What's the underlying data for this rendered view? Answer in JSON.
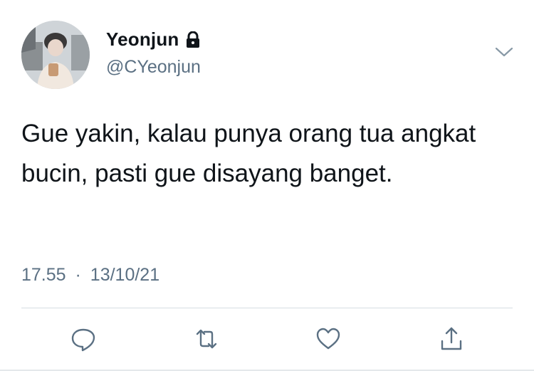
{
  "author": {
    "display_name": "Yeonjun",
    "handle": "@CYeonjun",
    "protected_icon": "lock-icon"
  },
  "tweet": {
    "text": "Gue yakin, kalau punya orang tua angkat bucin, pasti gue disayang banget.",
    "time": "17.55",
    "separator": "·",
    "date": "13/10/21"
  },
  "actions": [
    {
      "icon": "reply-icon"
    },
    {
      "icon": "retweet-icon"
    },
    {
      "icon": "like-icon"
    },
    {
      "icon": "share-icon"
    }
  ],
  "colors": {
    "text_primary": "#0f1419",
    "text_secondary": "#5b7083",
    "divider": "#d6dde2"
  }
}
